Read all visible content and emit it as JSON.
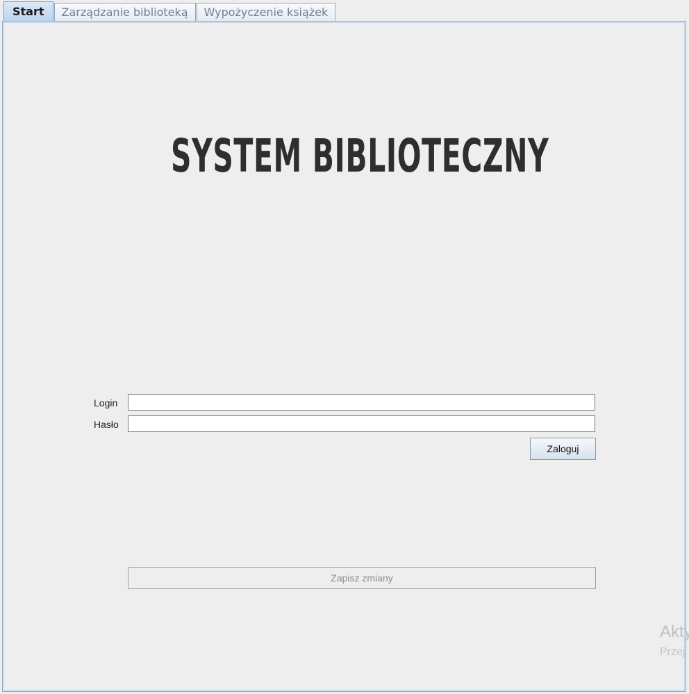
{
  "tabs": [
    {
      "label": "Start",
      "active": true
    },
    {
      "label": "Zarządzanie biblioteką",
      "active": false
    },
    {
      "label": "Wypożyczenie książek",
      "active": false
    }
  ],
  "main": {
    "title": "SYSTEM BIBLIOTECZNY",
    "login_label": "Login",
    "login_value": "",
    "password_label": "Hasło",
    "password_value": "",
    "login_button": "Zaloguj",
    "save_button": "Zapisz zmiany"
  },
  "watermark": {
    "line1": "Akty",
    "line2": "Przej"
  },
  "colors": {
    "background": "#eeeeee",
    "tab_active": "#bdd3ee",
    "border": "#8ea6c6",
    "title": "#2e2e2e",
    "disabled_text": "#8c8c8c"
  }
}
